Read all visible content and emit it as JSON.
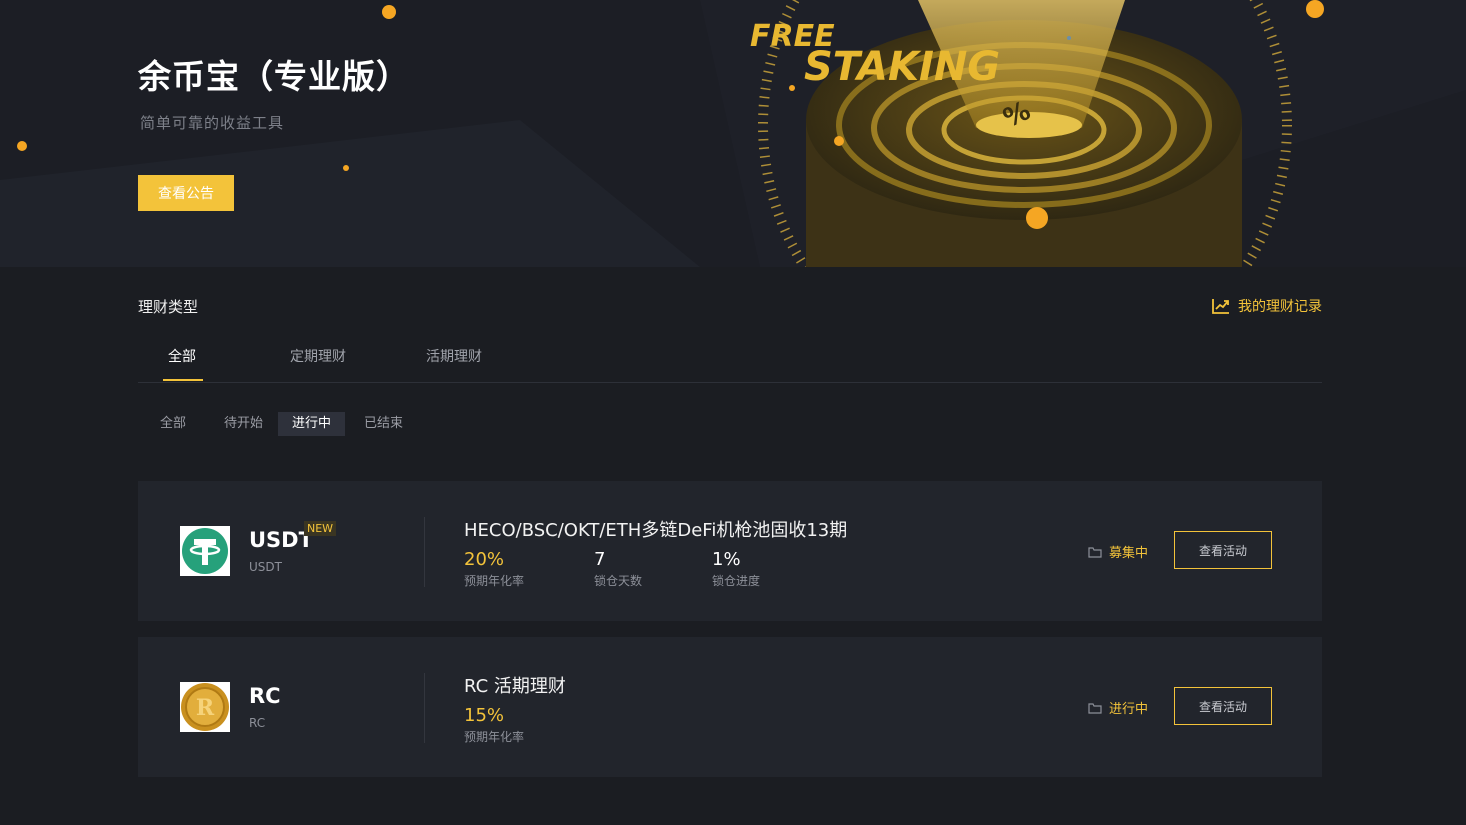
{
  "hero": {
    "title": "余币宝（专业版）",
    "subtitle": "简单可靠的收益工具",
    "button_label": "查看公告",
    "banner_line1": "FREE",
    "banner_line2": "STAKING",
    "banner_symbol": "%"
  },
  "section": {
    "title": "理财类型",
    "records_link": "我的理财记录"
  },
  "tabs": [
    {
      "label": "全部"
    },
    {
      "label": "定期理财"
    },
    {
      "label": "活期理财"
    }
  ],
  "filters": [
    {
      "label": "全部"
    },
    {
      "label": "待开始"
    },
    {
      "label": "进行中"
    },
    {
      "label": "已结束"
    }
  ],
  "products": [
    {
      "coin": "USDT",
      "coin_sub": "USDT",
      "badge": "NEW",
      "title": "HECO/BSC/OKT/ETH多链DeFi机枪池固收13期",
      "stats": [
        {
          "value": "20%",
          "label": "预期年化率"
        },
        {
          "value": "7",
          "label": "锁仓天数"
        },
        {
          "value": "1%",
          "label": "锁仓进度"
        }
      ],
      "status": "募集中",
      "action": "查看活动"
    },
    {
      "coin": "RC",
      "coin_sub": "RC",
      "title": "RC 活期理财",
      "stats": [
        {
          "value": "15%",
          "label": "预期年化率"
        }
      ],
      "status": "进行中",
      "action": "查看活动"
    }
  ],
  "colors": {
    "accent": "#f3c33a",
    "background": "#1b1d22",
    "card": "#22252c",
    "usdt_green": "#26a17b"
  }
}
